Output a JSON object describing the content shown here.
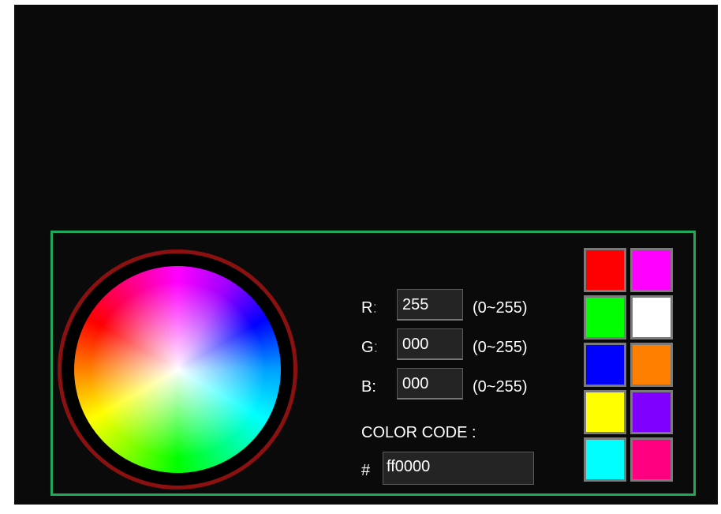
{
  "picker": {
    "r_label": "R",
    "g_label": "G",
    "b_label": "B",
    "colon": ":",
    "r_value": "255",
    "g_value": "000",
    "b_value": "000",
    "range_text": "(0~255)",
    "color_code_label": "COLOR CODE :",
    "hash": "#",
    "hex_value": "ff0000"
  },
  "colors": {
    "panel_border": "#22a85a",
    "wheel_ring": "#8b1010",
    "background": "#0a0a0a"
  },
  "swatches": [
    {
      "name": "red",
      "color": "#ff0000"
    },
    {
      "name": "magenta",
      "color": "#ff00ff"
    },
    {
      "name": "green",
      "color": "#00ff00"
    },
    {
      "name": "white",
      "color": "#ffffff"
    },
    {
      "name": "blue",
      "color": "#0000ff"
    },
    {
      "name": "orange",
      "color": "#ff8000"
    },
    {
      "name": "yellow",
      "color": "#ffff00"
    },
    {
      "name": "purple",
      "color": "#8000ff"
    },
    {
      "name": "cyan",
      "color": "#00ffff"
    },
    {
      "name": "pink",
      "color": "#ff0080"
    }
  ]
}
